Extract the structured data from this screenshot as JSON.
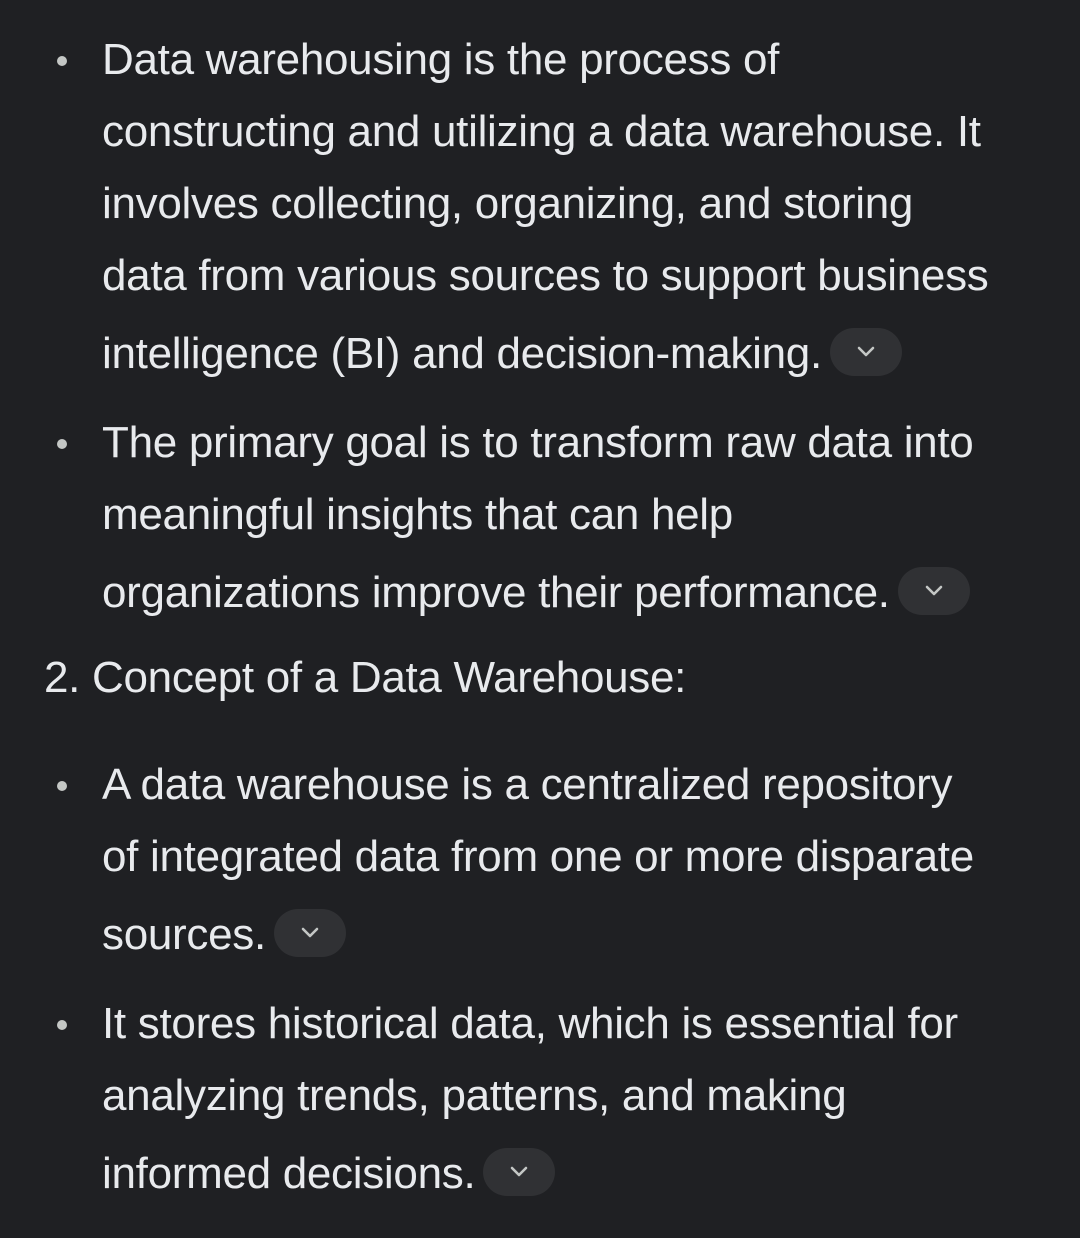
{
  "sections": [
    {
      "items": [
        {
          "lines": [
            "Data warehousing is the process of",
            "constructing and utilizing a data warehouse. It",
            "involves collecting, organizing, and storing",
            "data from various sources to support business",
            "intelligence (BI) and decision-making."
          ],
          "source_chip": "chevron-down-icon"
        },
        {
          "lines": [
            "The primary goal is to transform raw data into",
            "meaningful insights that can help",
            "organizations improve their performance."
          ],
          "source_chip": "chevron-down-icon"
        }
      ]
    },
    {
      "heading": "2. Concept of a Data Warehouse:",
      "items": [
        {
          "lines": [
            "A data warehouse is a centralized repository",
            "of integrated data from one or more disparate",
            "sources."
          ],
          "source_chip": "chevron-down-icon"
        },
        {
          "lines": [
            "It stores historical data, which is essential for",
            "analyzing trends, patterns, and making",
            "informed decisions."
          ],
          "source_chip": "chevron-down-icon"
        }
      ]
    }
  ],
  "colors": {
    "background": "#1f2023",
    "text": "#e8eaed",
    "chip": "#303134",
    "chevron": "#c4c7c5"
  }
}
